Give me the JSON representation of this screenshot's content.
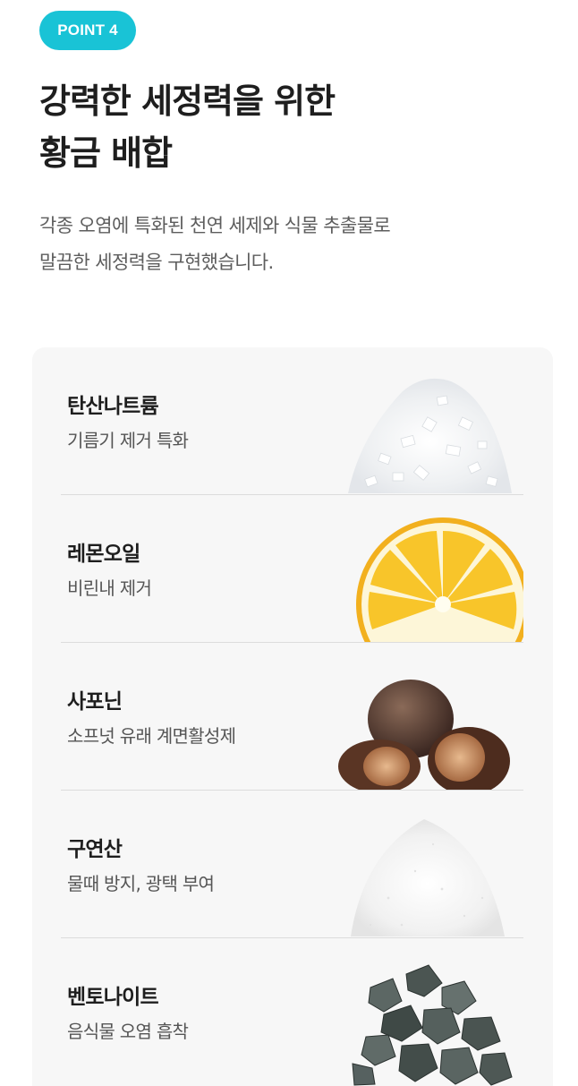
{
  "header": {
    "badge": "POINT 4",
    "title_line1": "강력한 세정력을 위한",
    "title_line2": "황금 배합",
    "desc_line1": "각종 오염에 특화된 천연 세제와 식물 추출물로",
    "desc_line2": "말끔한 세정력을 구현했습니다."
  },
  "ingredients": [
    {
      "name": "탄산나트륨",
      "desc": "기름기 제거 특화",
      "image": "coarse-salt-crystals"
    },
    {
      "name": "레몬오일",
      "desc": "비린내 제거",
      "image": "lemon-slice"
    },
    {
      "name": "사포닌",
      "desc": "소프넛 유래 계면활성제",
      "image": "soapnuts"
    },
    {
      "name": "구연산",
      "desc": "물때 방지, 광택 부여",
      "image": "citric-acid-powder"
    },
    {
      "name": "벤토나이트",
      "desc": "음식물 오염 흡착",
      "image": "bentonite-stones"
    }
  ]
}
